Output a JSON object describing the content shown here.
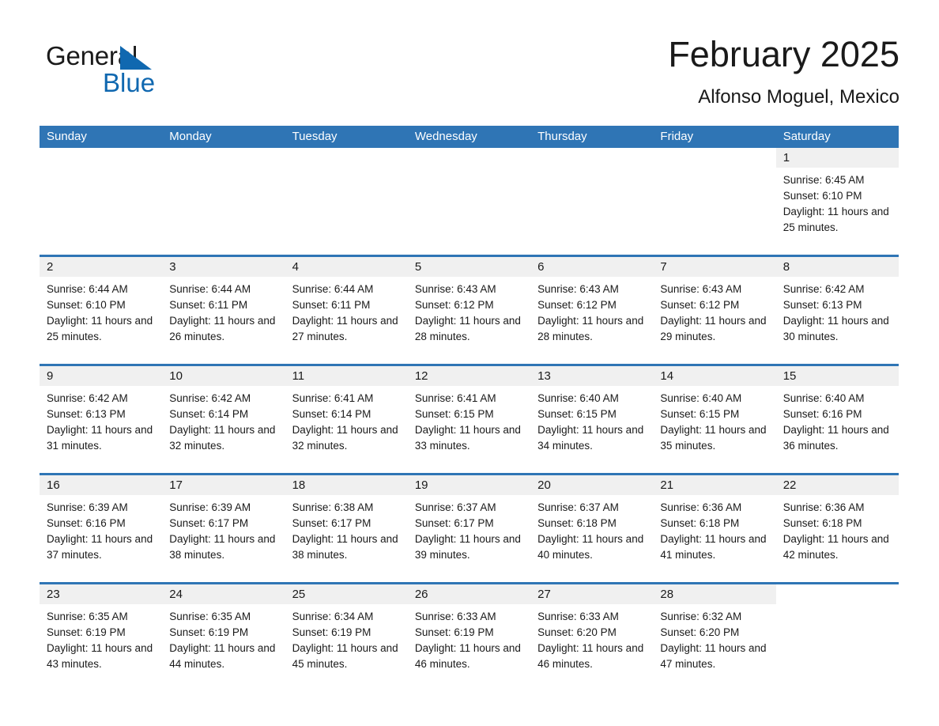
{
  "logo": {
    "word_one": "General",
    "word_two": "Blue",
    "triangle_color": "#1068b0"
  },
  "header": {
    "title": "February 2025",
    "subtitle": "Alfonso Moguel, Mexico"
  },
  "theme": {
    "accent": "#2f75b5",
    "day_band": "#f0f0f0",
    "text": "#1a1a1a"
  },
  "weekdays": [
    "Sunday",
    "Monday",
    "Tuesday",
    "Wednesday",
    "Thursday",
    "Friday",
    "Saturday"
  ],
  "weeks": [
    [
      {
        "day": "",
        "sunrise": "",
        "sunset": "",
        "daylight": "",
        "blank": true
      },
      {
        "day": "",
        "sunrise": "",
        "sunset": "",
        "daylight": "",
        "blank": true
      },
      {
        "day": "",
        "sunrise": "",
        "sunset": "",
        "daylight": "",
        "blank": true
      },
      {
        "day": "",
        "sunrise": "",
        "sunset": "",
        "daylight": "",
        "blank": true
      },
      {
        "day": "",
        "sunrise": "",
        "sunset": "",
        "daylight": "",
        "blank": true
      },
      {
        "day": "",
        "sunrise": "",
        "sunset": "",
        "daylight": "",
        "blank": true
      },
      {
        "day": "1",
        "sunrise": "Sunrise: 6:45 AM",
        "sunset": "Sunset: 6:10 PM",
        "daylight": "Daylight: 11 hours and 25 minutes.",
        "blank": false
      }
    ],
    [
      {
        "day": "2",
        "sunrise": "Sunrise: 6:44 AM",
        "sunset": "Sunset: 6:10 PM",
        "daylight": "Daylight: 11 hours and 25 minutes.",
        "blank": false
      },
      {
        "day": "3",
        "sunrise": "Sunrise: 6:44 AM",
        "sunset": "Sunset: 6:11 PM",
        "daylight": "Daylight: 11 hours and 26 minutes.",
        "blank": false
      },
      {
        "day": "4",
        "sunrise": "Sunrise: 6:44 AM",
        "sunset": "Sunset: 6:11 PM",
        "daylight": "Daylight: 11 hours and 27 minutes.",
        "blank": false
      },
      {
        "day": "5",
        "sunrise": "Sunrise: 6:43 AM",
        "sunset": "Sunset: 6:12 PM",
        "daylight": "Daylight: 11 hours and 28 minutes.",
        "blank": false
      },
      {
        "day": "6",
        "sunrise": "Sunrise: 6:43 AM",
        "sunset": "Sunset: 6:12 PM",
        "daylight": "Daylight: 11 hours and 28 minutes.",
        "blank": false
      },
      {
        "day": "7",
        "sunrise": "Sunrise: 6:43 AM",
        "sunset": "Sunset: 6:12 PM",
        "daylight": "Daylight: 11 hours and 29 minutes.",
        "blank": false
      },
      {
        "day": "8",
        "sunrise": "Sunrise: 6:42 AM",
        "sunset": "Sunset: 6:13 PM",
        "daylight": "Daylight: 11 hours and 30 minutes.",
        "blank": false
      }
    ],
    [
      {
        "day": "9",
        "sunrise": "Sunrise: 6:42 AM",
        "sunset": "Sunset: 6:13 PM",
        "daylight": "Daylight: 11 hours and 31 minutes.",
        "blank": false
      },
      {
        "day": "10",
        "sunrise": "Sunrise: 6:42 AM",
        "sunset": "Sunset: 6:14 PM",
        "daylight": "Daylight: 11 hours and 32 minutes.",
        "blank": false
      },
      {
        "day": "11",
        "sunrise": "Sunrise: 6:41 AM",
        "sunset": "Sunset: 6:14 PM",
        "daylight": "Daylight: 11 hours and 32 minutes.",
        "blank": false
      },
      {
        "day": "12",
        "sunrise": "Sunrise: 6:41 AM",
        "sunset": "Sunset: 6:15 PM",
        "daylight": "Daylight: 11 hours and 33 minutes.",
        "blank": false
      },
      {
        "day": "13",
        "sunrise": "Sunrise: 6:40 AM",
        "sunset": "Sunset: 6:15 PM",
        "daylight": "Daylight: 11 hours and 34 minutes.",
        "blank": false
      },
      {
        "day": "14",
        "sunrise": "Sunrise: 6:40 AM",
        "sunset": "Sunset: 6:15 PM",
        "daylight": "Daylight: 11 hours and 35 minutes.",
        "blank": false
      },
      {
        "day": "15",
        "sunrise": "Sunrise: 6:40 AM",
        "sunset": "Sunset: 6:16 PM",
        "daylight": "Daylight: 11 hours and 36 minutes.",
        "blank": false
      }
    ],
    [
      {
        "day": "16",
        "sunrise": "Sunrise: 6:39 AM",
        "sunset": "Sunset: 6:16 PM",
        "daylight": "Daylight: 11 hours and 37 minutes.",
        "blank": false
      },
      {
        "day": "17",
        "sunrise": "Sunrise: 6:39 AM",
        "sunset": "Sunset: 6:17 PM",
        "daylight": "Daylight: 11 hours and 38 minutes.",
        "blank": false
      },
      {
        "day": "18",
        "sunrise": "Sunrise: 6:38 AM",
        "sunset": "Sunset: 6:17 PM",
        "daylight": "Daylight: 11 hours and 38 minutes.",
        "blank": false
      },
      {
        "day": "19",
        "sunrise": "Sunrise: 6:37 AM",
        "sunset": "Sunset: 6:17 PM",
        "daylight": "Daylight: 11 hours and 39 minutes.",
        "blank": false
      },
      {
        "day": "20",
        "sunrise": "Sunrise: 6:37 AM",
        "sunset": "Sunset: 6:18 PM",
        "daylight": "Daylight: 11 hours and 40 minutes.",
        "blank": false
      },
      {
        "day": "21",
        "sunrise": "Sunrise: 6:36 AM",
        "sunset": "Sunset: 6:18 PM",
        "daylight": "Daylight: 11 hours and 41 minutes.",
        "blank": false
      },
      {
        "day": "22",
        "sunrise": "Sunrise: 6:36 AM",
        "sunset": "Sunset: 6:18 PM",
        "daylight": "Daylight: 11 hours and 42 minutes.",
        "blank": false
      }
    ],
    [
      {
        "day": "23",
        "sunrise": "Sunrise: 6:35 AM",
        "sunset": "Sunset: 6:19 PM",
        "daylight": "Daylight: 11 hours and 43 minutes.",
        "blank": false
      },
      {
        "day": "24",
        "sunrise": "Sunrise: 6:35 AM",
        "sunset": "Sunset: 6:19 PM",
        "daylight": "Daylight: 11 hours and 44 minutes.",
        "blank": false
      },
      {
        "day": "25",
        "sunrise": "Sunrise: 6:34 AM",
        "sunset": "Sunset: 6:19 PM",
        "daylight": "Daylight: 11 hours and 45 minutes.",
        "blank": false
      },
      {
        "day": "26",
        "sunrise": "Sunrise: 6:33 AM",
        "sunset": "Sunset: 6:19 PM",
        "daylight": "Daylight: 11 hours and 46 minutes.",
        "blank": false
      },
      {
        "day": "27",
        "sunrise": "Sunrise: 6:33 AM",
        "sunset": "Sunset: 6:20 PM",
        "daylight": "Daylight: 11 hours and 46 minutes.",
        "blank": false
      },
      {
        "day": "28",
        "sunrise": "Sunrise: 6:32 AM",
        "sunset": "Sunset: 6:20 PM",
        "daylight": "Daylight: 11 hours and 47 minutes.",
        "blank": false
      },
      {
        "day": "",
        "sunrise": "",
        "sunset": "",
        "daylight": "",
        "blank": true
      }
    ]
  ]
}
